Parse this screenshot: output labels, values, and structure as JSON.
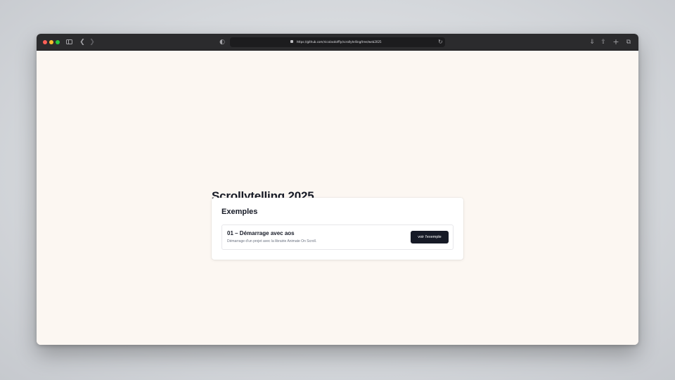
{
  "browser": {
    "url": "https://github.com/nicolasdoffly/scrollytelling/tree/web2025",
    "icons": [
      "close-dot",
      "minimize-dot",
      "zoom-dot",
      "sidebar-toggle-icon",
      "back-chevron-icon",
      "forward-chevron-icon",
      "privacy-shield-icon",
      "lock-icon",
      "reload-icon",
      "download-icon",
      "share-icon",
      "new-tab-plus-icon",
      "tab-overview-icon"
    ],
    "colors": {
      "toolbar": "#2b2b2d",
      "close": "#fe5f57",
      "minimize": "#febc2e",
      "zoom": "#28c840"
    }
  },
  "page": {
    "title": "Scrollytelling 2025",
    "background": "#fcf7f2",
    "card": {
      "title": "Exemples",
      "examples": [
        {
          "title": "01 – Démarrage avec aos",
          "description": "Démarrage d'un projet avec la librairie Animate On Scroll.",
          "button_label": "voir l'exemple"
        }
      ]
    },
    "colors": {
      "text": "#161a26",
      "button": "#161a26",
      "muted": "#6b7280"
    }
  }
}
